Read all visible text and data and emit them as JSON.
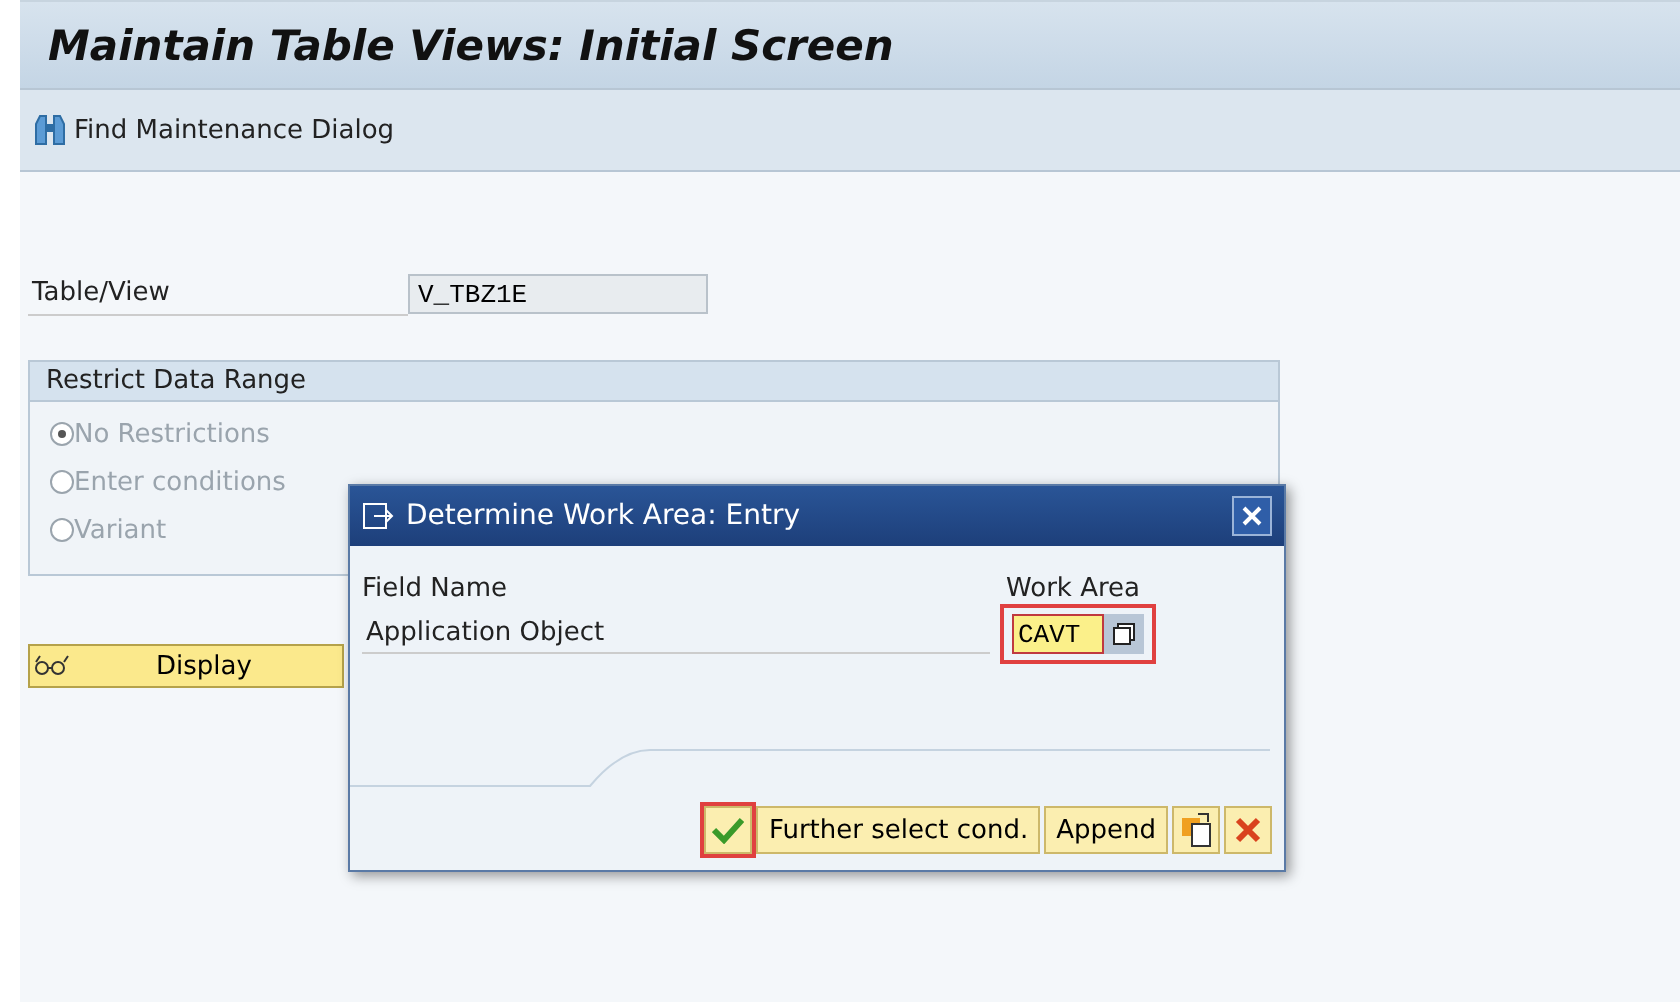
{
  "window": {
    "title": "Maintain Table Views: Initial Screen"
  },
  "toolbar": {
    "items": [
      {
        "label": "Find Maintenance Dialog"
      }
    ]
  },
  "table_view": {
    "label": "Table/View",
    "value": "V_TBZ1E"
  },
  "restrict_group": {
    "title": "Restrict Data Range",
    "options": [
      {
        "label": "No Restrictions",
        "selected": true
      },
      {
        "label": "Enter conditions",
        "selected": false
      },
      {
        "label": "Variant",
        "selected": false
      }
    ]
  },
  "display_button": {
    "label": "Display"
  },
  "dialog": {
    "title": "Determine Work Area: Entry",
    "columns": [
      "Field Name",
      "Work Area"
    ],
    "rows": [
      {
        "field": "Application Object",
        "value": "CAVT",
        "highlighted": true
      }
    ],
    "buttons": [
      {
        "kind": "confirm",
        "highlighted": true
      },
      {
        "kind": "text",
        "label": "Further select cond."
      },
      {
        "kind": "text",
        "label": "Append"
      },
      {
        "kind": "paste"
      },
      {
        "kind": "cancel"
      }
    ]
  }
}
